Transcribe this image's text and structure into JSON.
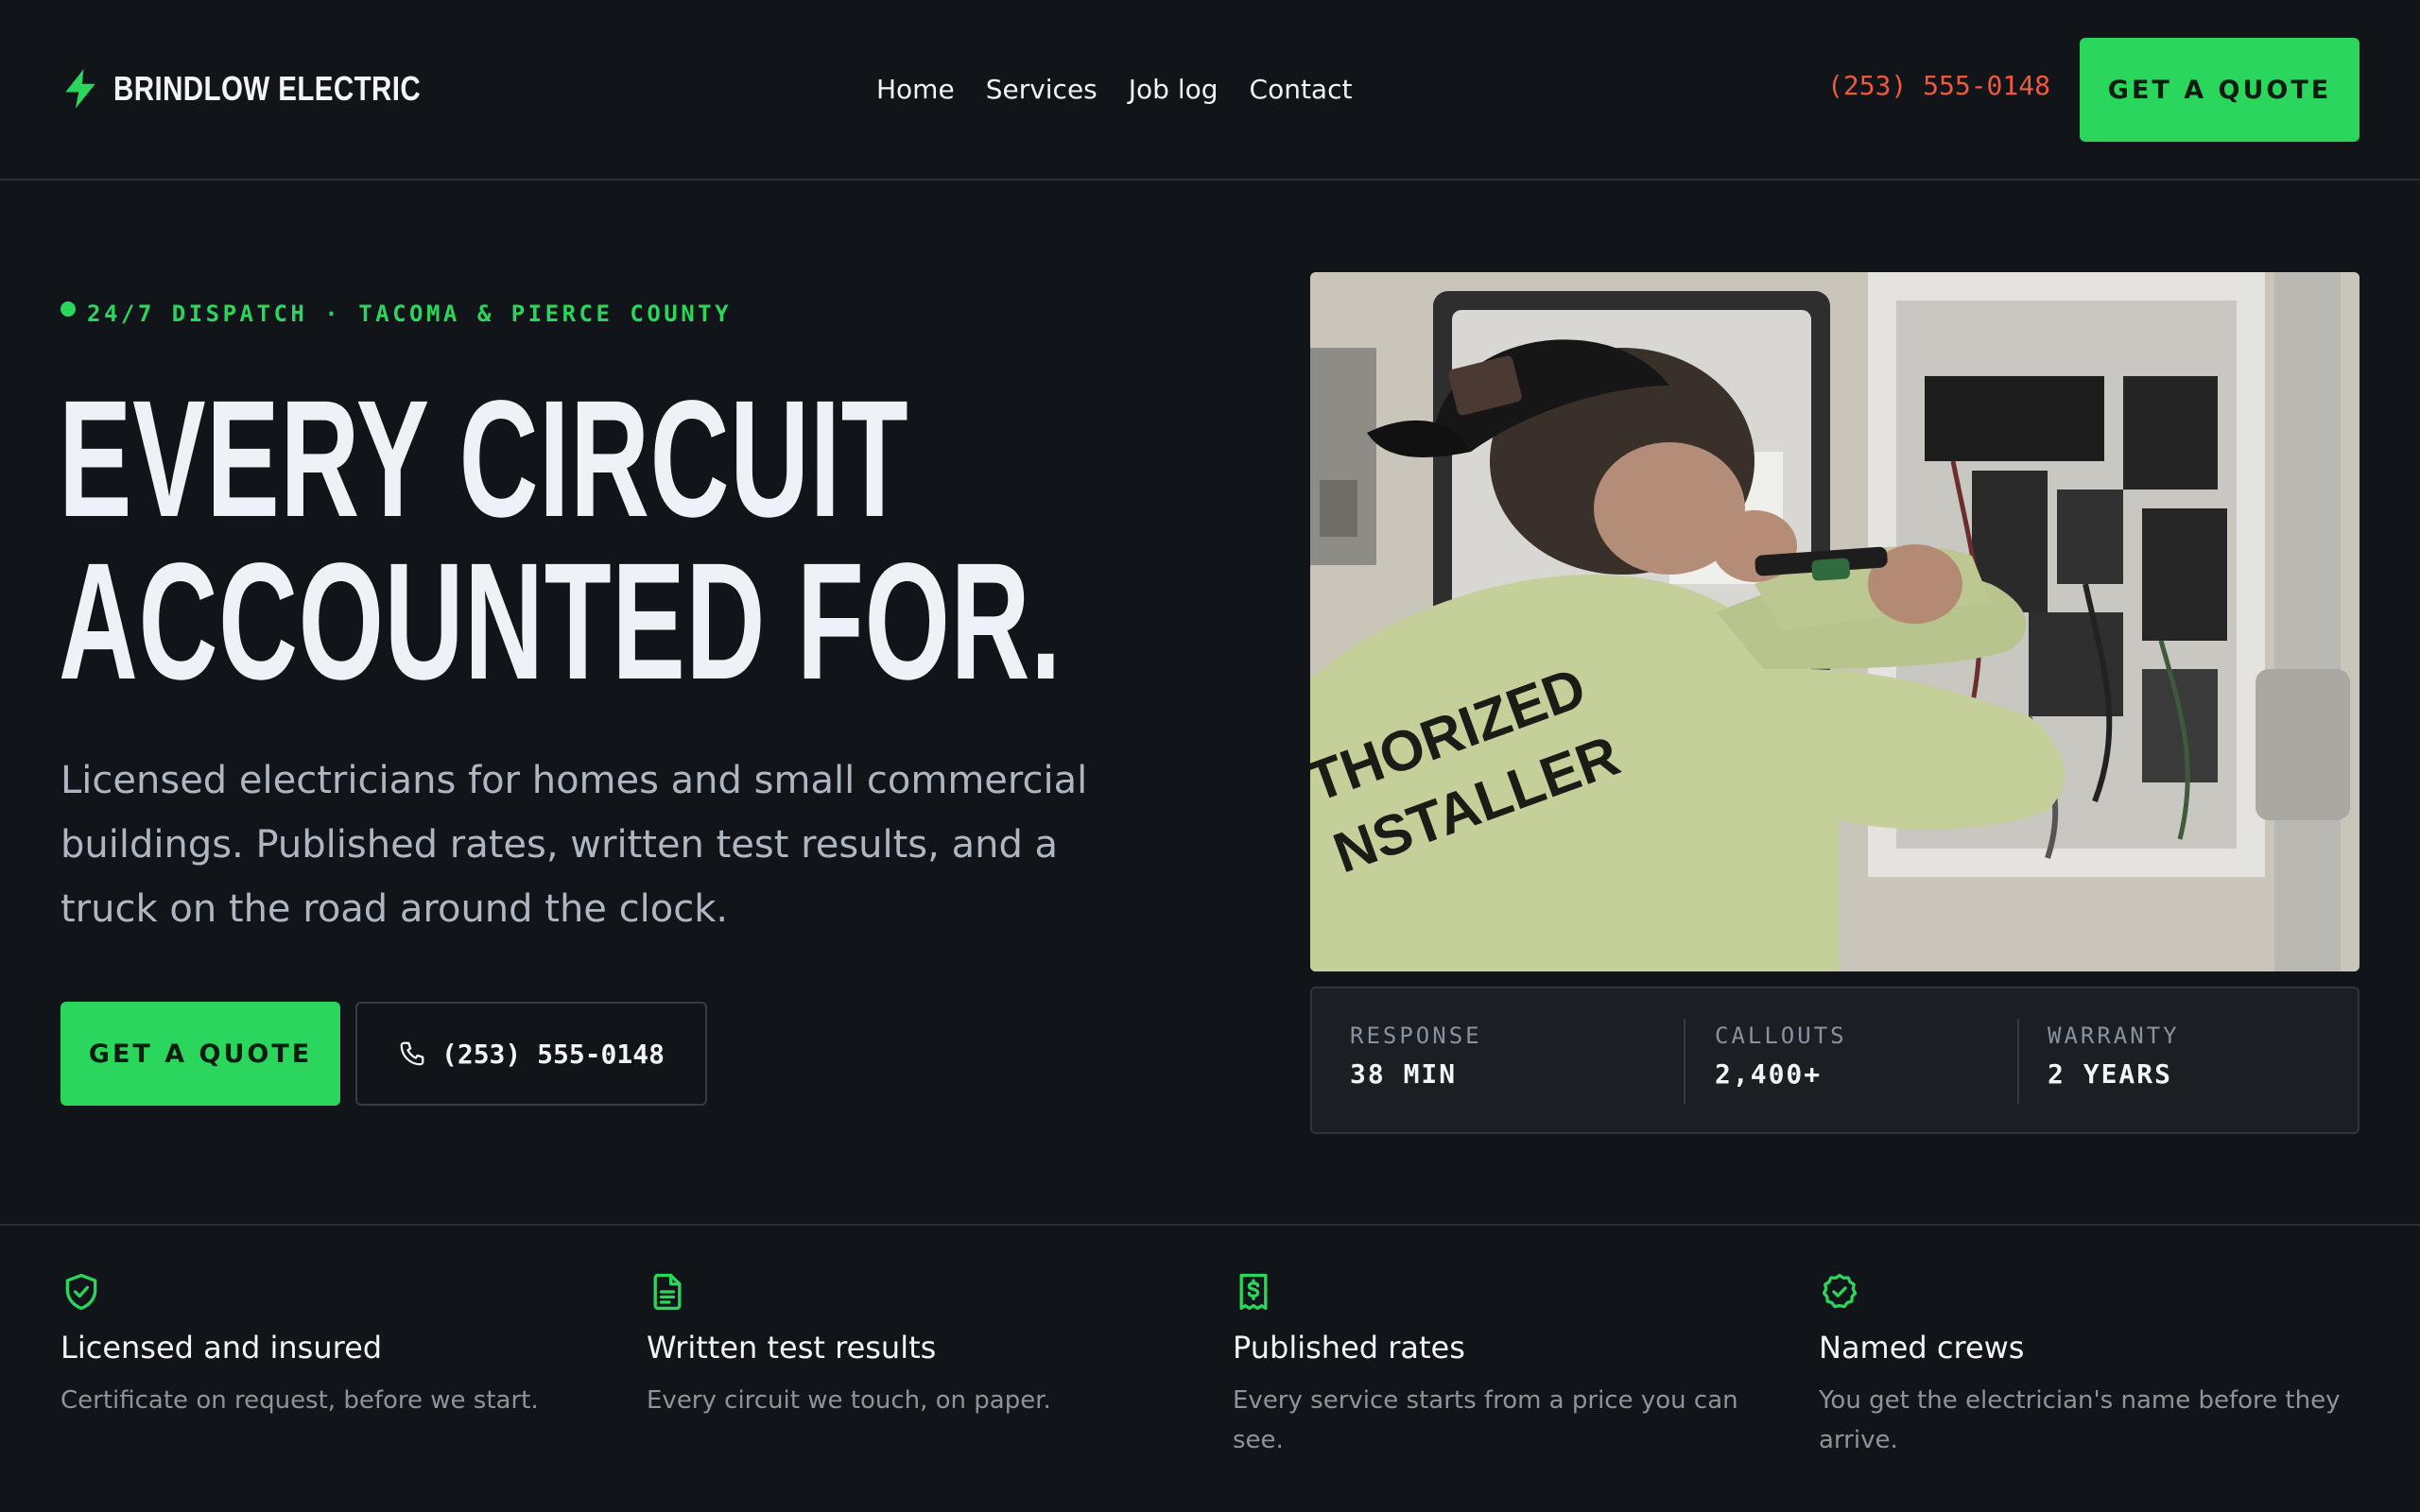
{
  "colors": {
    "background": "#111418",
    "accent": "#2bd65d",
    "phone_accent": "#f0593d",
    "panel": "#1b1f24"
  },
  "nav": {
    "brand_icon": "lightning-bolt-icon",
    "brand_name": "BRINDLOW ELECTRIC",
    "links": [
      {
        "label": "Home"
      },
      {
        "label": "Services"
      },
      {
        "label": "Job log"
      },
      {
        "label": "Contact"
      }
    ],
    "phone": "(253) 555-0148",
    "cta_label": "GET A QUOTE"
  },
  "hero": {
    "eyebrow": "24/7 DISPATCH · TACOMA & PIERCE COUNTY",
    "headline_lines": [
      "EVERY CIRCUIT",
      "ACCOUNTED FOR."
    ],
    "lede": "Licensed electricians for homes and small commercial buildings. Published rates, written test results, and a truck on the road around the clock.",
    "cta_label": "GET A QUOTE",
    "call_icon": "phone-icon",
    "call_label": "(253) 555-0148",
    "photo_shirt_text": [
      "THORIZED",
      "NSTALLER"
    ]
  },
  "stats": [
    {
      "label": "RESPONSE",
      "value": "38 MIN"
    },
    {
      "label": "CALLOUTS",
      "value": "2,400+"
    },
    {
      "label": "WARRANTY",
      "value": "2 YEARS"
    }
  ],
  "features": [
    {
      "icon": "shield-check-icon",
      "title": "Licensed and insured",
      "description": "Certificate on request, before we start."
    },
    {
      "icon": "document-icon",
      "title": "Written test results",
      "description": "Every circuit we touch, on paper."
    },
    {
      "icon": "dollar-receipt-icon",
      "title": "Published rates",
      "description": "Every service starts from a price you can see."
    },
    {
      "icon": "badge-check-icon",
      "title": "Named crews",
      "description": "You get the electrician's name before they arrive."
    }
  ]
}
